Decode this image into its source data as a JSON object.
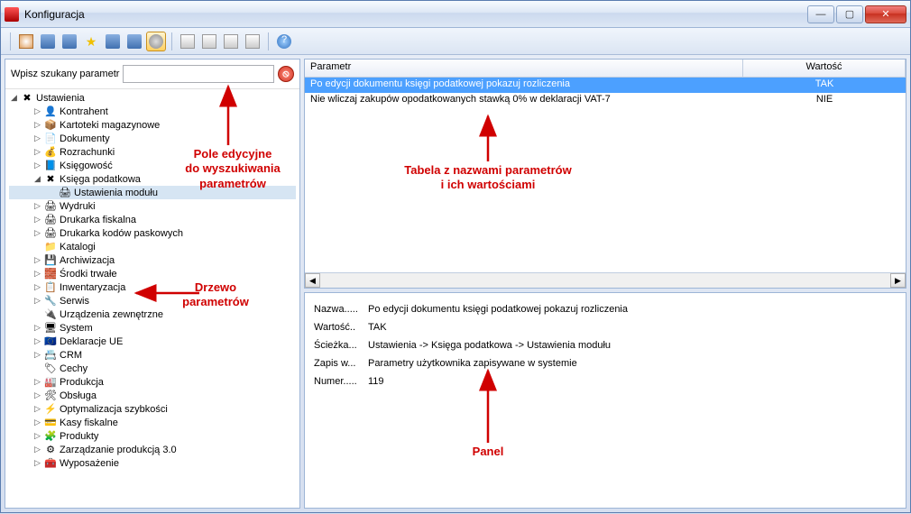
{
  "window": {
    "title": "Konfiguracja"
  },
  "search": {
    "label": "Wpisz szukany parametr",
    "value": ""
  },
  "tree": {
    "root": "Ustawienia",
    "items": [
      {
        "label": "Kontrahent",
        "icon": "👤",
        "depth": 1,
        "expand": "▷"
      },
      {
        "label": "Kartoteki magazynowe",
        "icon": "📦",
        "depth": 1,
        "expand": "▷"
      },
      {
        "label": "Dokumenty",
        "icon": "📄",
        "depth": 1,
        "expand": "▷"
      },
      {
        "label": "Rozrachunki",
        "icon": "💰",
        "depth": 1,
        "expand": "▷"
      },
      {
        "label": "Księgowość",
        "icon": "📘",
        "depth": 1,
        "expand": "▷"
      },
      {
        "label": "Księga podatkowa",
        "icon": "✖",
        "depth": 1,
        "expand": "◢"
      },
      {
        "label": "Ustawienia modułu",
        "icon": "🖨",
        "depth": 2,
        "expand": "",
        "selected": true
      },
      {
        "label": "Wydruki",
        "icon": "🖨",
        "depth": 1,
        "expand": "▷"
      },
      {
        "label": "Drukarka fiskalna",
        "icon": "🖨",
        "depth": 1,
        "expand": "▷"
      },
      {
        "label": "Drukarka kodów paskowych",
        "icon": "🖨",
        "depth": 1,
        "expand": "▷"
      },
      {
        "label": "Katalogi",
        "icon": "📁",
        "depth": 1,
        "expand": ""
      },
      {
        "label": "Archiwizacja",
        "icon": "💾",
        "depth": 1,
        "expand": "▷"
      },
      {
        "label": "Środki trwałe",
        "icon": "🧱",
        "depth": 1,
        "expand": "▷"
      },
      {
        "label": "Inwentaryzacja",
        "icon": "📋",
        "depth": 1,
        "expand": "▷"
      },
      {
        "label": "Serwis",
        "icon": "🔧",
        "depth": 1,
        "expand": "▷"
      },
      {
        "label": "Urządzenia zewnętrzne",
        "icon": "🔌",
        "depth": 1,
        "expand": ""
      },
      {
        "label": "System",
        "icon": "🖥",
        "depth": 1,
        "expand": "▷"
      },
      {
        "label": "Deklaracje UE",
        "icon": "🇪🇺",
        "depth": 1,
        "expand": "▷"
      },
      {
        "label": "CRM",
        "icon": "📇",
        "depth": 1,
        "expand": "▷"
      },
      {
        "label": "Cechy",
        "icon": "🏷",
        "depth": 1,
        "expand": ""
      },
      {
        "label": "Produkcja",
        "icon": "🏭",
        "depth": 1,
        "expand": "▷"
      },
      {
        "label": "Obsługa",
        "icon": "🛠",
        "depth": 1,
        "expand": "▷"
      },
      {
        "label": "Optymalizacja szybkości",
        "icon": "⚡",
        "depth": 1,
        "expand": "▷"
      },
      {
        "label": "Kasy fiskalne",
        "icon": "💳",
        "depth": 1,
        "expand": "▷"
      },
      {
        "label": "Produkty",
        "icon": "🧩",
        "depth": 1,
        "expand": "▷"
      },
      {
        "label": "Zarządzanie produkcją 3.0",
        "icon": "⚙",
        "depth": 1,
        "expand": "▷"
      },
      {
        "label": "Wyposażenie",
        "icon": "🧰",
        "depth": 1,
        "expand": "▷"
      }
    ]
  },
  "table": {
    "headers": {
      "param": "Parametr",
      "value": "Wartość"
    },
    "rows": [
      {
        "param": "Po edycji dokumentu księgi podatkowej pokazuj rozliczenia",
        "value": "TAK",
        "selected": true
      },
      {
        "param": "Nie wliczaj zakupów opodatkowanych stawką 0% w deklaracji VAT-7",
        "value": "NIE",
        "selected": false
      }
    ]
  },
  "detail": {
    "labels": {
      "name": "Nazwa.....",
      "value": "Wartość..",
      "path": "Ścieżka...",
      "save": "Zapis w...",
      "number": "Numer....."
    },
    "name": "Po edycji dokumentu księgi podatkowej pokazuj rozliczenia",
    "value": "TAK",
    "path": "Ustawienia -> Księga podatkowa -> Ustawienia modułu",
    "save": "Parametry użytkownika zapisywane w systemie",
    "number": "119"
  },
  "annotations": {
    "search": "Pole edycyjne\ndo wyszukiwania\nparametrów",
    "table": "Tabela z nazwami parametrów\ni ich wartościami",
    "tree": "Drzewo\nparametrów",
    "panel": "Panel"
  }
}
